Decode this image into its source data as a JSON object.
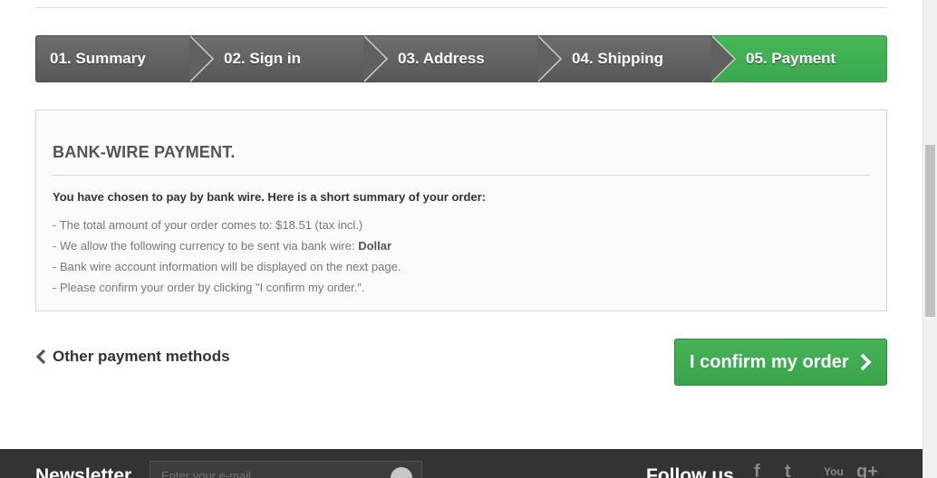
{
  "steps": [
    {
      "label": "01. Summary",
      "active": false
    },
    {
      "label": "02. Sign in",
      "active": false
    },
    {
      "label": "03. Address",
      "active": false
    },
    {
      "label": "04. Shipping",
      "active": false
    },
    {
      "label": "05. Payment",
      "active": true
    }
  ],
  "payment_box": {
    "title": "BANK-WIRE PAYMENT.",
    "intro": "You have chosen to pay by bank wire. Here is a short summary of your order:",
    "lines": {
      "total": "- The total amount of your order comes to: $18.51 (tax incl.)",
      "currency_prefix": "- We allow the following currency to be sent via bank wire: ",
      "currency_value": "Dollar",
      "account_info": "- Bank wire account information will be displayed on the next page.",
      "confirm_hint": "- Please confirm your order by clicking \"I confirm my order.\"."
    }
  },
  "actions": {
    "other_methods": "Other payment methods",
    "confirm": "I confirm my order"
  },
  "footer": {
    "newsletter_title": "Newsletter",
    "newsletter_placeholder": "Enter your e-mail",
    "follow_title": "Follow us",
    "social": {
      "facebook": "f",
      "twitter": "t",
      "youtube": "You",
      "google_plus": "g+"
    }
  },
  "colors": {
    "accent_green": "#3aa84c",
    "step_gray": "#606060",
    "footer_bg": "#333333"
  }
}
